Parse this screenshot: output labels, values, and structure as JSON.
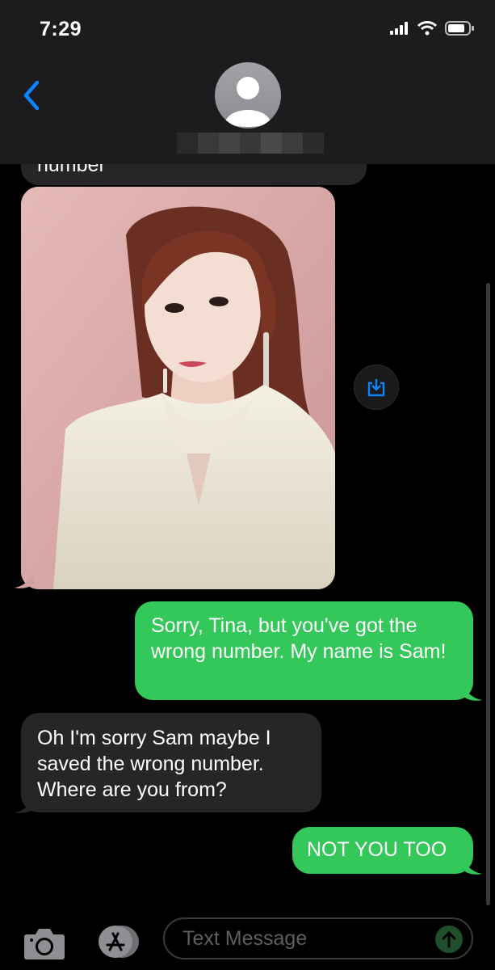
{
  "status_bar": {
    "time": "7:29"
  },
  "conversation": {
    "partial_message_text": "number",
    "messages": [
      {
        "direction": "outgoing",
        "text": "Sorry, Tina, but you've got the wrong number. My name is Sam!"
      },
      {
        "direction": "incoming",
        "text": "Oh I'm sorry  Sam maybe I saved the wrong number. Where are you from?"
      },
      {
        "direction": "outgoing",
        "text": "NOT YOU TOO"
      }
    ]
  },
  "composer": {
    "placeholder": "Text Message"
  },
  "colors": {
    "outgoing_bubble": "#34c759",
    "incoming_bubble": "#262628",
    "accent": "#0a84ff"
  },
  "icons": [
    "back-chevron-icon",
    "avatar-icon",
    "wifi-icon",
    "cellular-icon",
    "battery-icon",
    "save-photo-icon",
    "camera-icon",
    "app-store-icon",
    "send-arrow-icon"
  ]
}
